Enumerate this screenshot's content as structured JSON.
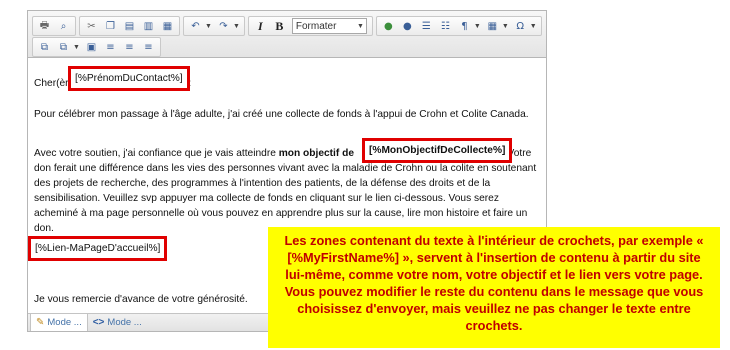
{
  "toolbar": {
    "row1": [
      "printer-icon",
      "binoculars-icon",
      "cut-icon",
      "copy-icon",
      "paste-icon",
      "paste-text-icon",
      "paste-word-icon",
      "undo-icon",
      "redo-icon",
      "italic-icon",
      "bold-icon",
      "format-select",
      "spellcheck-icon",
      "spellcheck-options-icon",
      "ordered-list-icon",
      "unordered-list-icon",
      "paragraph-icon",
      "table-icon",
      "special-char-icon"
    ],
    "italic_label": "I",
    "bold_label": "B",
    "format_value": "Formater",
    "special_char_label": "Ω",
    "paragraph_label": "¶"
  },
  "content": {
    "greeting_prefix": "Cher(ère) ",
    "greeting_token": "[%PrénomDuContact%]",
    "greeting_suffix": ":",
    "paragraph1": "Pour célébrer mon passage à l'âge adulte, j'ai créé une collecte de fonds à l'appui de Crohn et Colite Canada.",
    "paragraph2_start": "Avec votre soutien, j'ai confiance que je vais atteindre ",
    "paragraph2_bold": "mon objectif de ",
    "goal_token": "[%MonObjectifDeCollecte%]",
    "paragraph2_end": ". Votre don ferait une différence dans les vies des personnes vivant avec la maladie de Crohn ou la colite en soutenant des projets de recherche, des programmes à l'intention des patients, de la défense des droits et de la sensibilisation. Veuillez svp appuyer ma collecte de fonds en cliquant sur le lien ci-dessous. Vous serez acheminé à ma page personnelle où vous pouvez en apprendre plus sur la cause, lire mon histoire et faire un don.",
    "homepage_token": "[%Lien-MaPageD'accueil%]",
    "closing": "Je vous remercie d'avance de votre générosité."
  },
  "statusbar": {
    "design_mode_label": "Mode ...",
    "html_mode_label": "Mode ..."
  },
  "note": {
    "text": "Les zones contenant du texte à l'intérieur de crochets, par exemple « [%MyFirstName%] », servent à l'insertion de contenu à partir du site lui-même, comme votre nom, votre objectif et le lien vers votre page. Vous pouvez modifier le reste du contenu dans le message que vous choisissez d'envoyer, mais veuillez ne pas changer le texte entre crochets."
  },
  "colors": {
    "highlight_border": "#e00000",
    "note_background": "#ffff00",
    "note_text": "#c00000"
  }
}
